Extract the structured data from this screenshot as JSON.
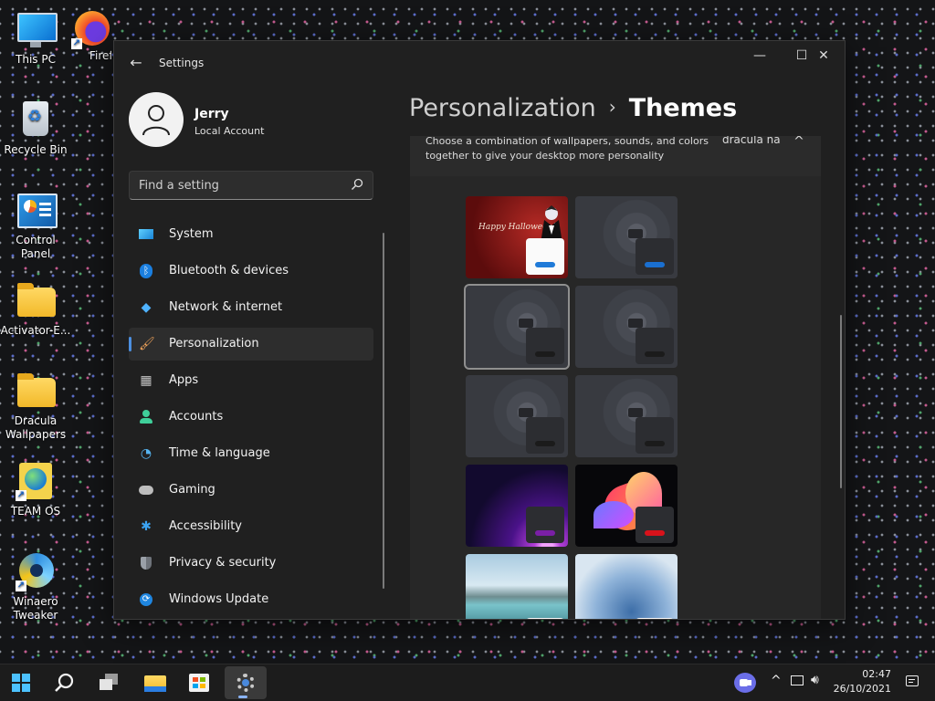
{
  "desktop": {
    "icons": [
      {
        "label": "This PC"
      },
      {
        "label": "Firefo"
      },
      {
        "label": "Recycle Bin"
      },
      {
        "label": "Control Panel"
      },
      {
        "label": "Activator-E..."
      },
      {
        "label": "Dracula Wallpapers"
      },
      {
        "label": "TEAM OS"
      },
      {
        "label": "Winaero Tweaker"
      }
    ]
  },
  "window": {
    "title": "Settings",
    "back_icon": "←",
    "controls": {
      "minimize": "—",
      "maximize": "☐",
      "close": "✕"
    }
  },
  "profile": {
    "name": "Jerry",
    "account_type": "Local Account"
  },
  "search": {
    "placeholder": "Find a setting"
  },
  "sidebar": {
    "items": [
      {
        "label": "System",
        "icon": "system-icon"
      },
      {
        "label": "Bluetooth & devices",
        "icon": "bluetooth-icon"
      },
      {
        "label": "Network & internet",
        "icon": "wifi-icon"
      },
      {
        "label": "Personalization",
        "icon": "brush-icon",
        "active": true
      },
      {
        "label": "Apps",
        "icon": "apps-icon"
      },
      {
        "label": "Accounts",
        "icon": "accounts-icon"
      },
      {
        "label": "Time & language",
        "icon": "clock-globe-icon"
      },
      {
        "label": "Gaming",
        "icon": "gamepad-icon"
      },
      {
        "label": "Accessibility",
        "icon": "accessibility-icon"
      },
      {
        "label": "Privacy & security",
        "icon": "shield-icon"
      },
      {
        "label": "Windows Update",
        "icon": "update-icon"
      }
    ]
  },
  "breadcrumb": {
    "parent": "Personalization",
    "separator": "›",
    "current": "Themes"
  },
  "themes": {
    "description": "Choose a combination of wallpapers, sounds, and colors together to give your desktop more personality",
    "current": "dracula na",
    "halloween_text": "Happy Halloween!",
    "accent_colors": {
      "dracula": "#1f7ad8",
      "bat_blue": "#1a6fd0",
      "bat_dark": "#1b1b1b",
      "purple": "#7a1fa6",
      "bloom": "#d9121b"
    }
  },
  "taskbar": {
    "time": "02:47",
    "date": "26/10/2021",
    "chevron": "^"
  }
}
